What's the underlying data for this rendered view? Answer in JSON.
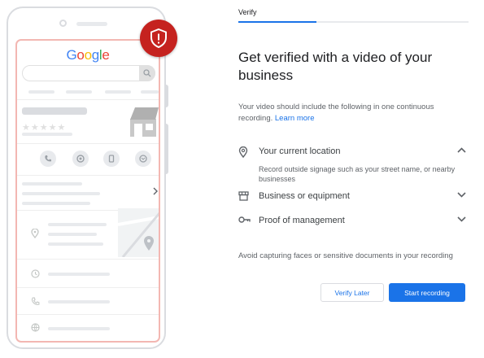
{
  "phone": {
    "logo_text": "Google",
    "logo_colors": [
      "#4285f4",
      "#ea4335",
      "#fbbc05",
      "#4285f4",
      "#34a853",
      "#ea4335"
    ],
    "badge_icon": "shield-alert-icon",
    "badge_color": "#c5221f",
    "action_icons": [
      "phone-icon",
      "directions-icon",
      "save-icon",
      "website-icon"
    ],
    "row_icons": [
      "location-pin-icon",
      "clock-icon",
      "phone-icon",
      "globe-icon"
    ],
    "rating_stars": 5
  },
  "tab": {
    "label": "Verify",
    "progress": 0.34,
    "accent": "#1a73e8"
  },
  "main": {
    "title": "Get verified with a video of your business",
    "description": "Your video should include the following in one continuous recording.",
    "learn_more": "Learn more",
    "items": [
      {
        "icon": "location-pin-icon",
        "label": "Your current location",
        "expanded": true,
        "detail": "Record outside signage such as your street name, or nearby businesses"
      },
      {
        "icon": "storefront-icon",
        "label": "Business or equipment",
        "expanded": false
      },
      {
        "icon": "key-icon",
        "label": "Proof of management",
        "expanded": false
      }
    ],
    "note": "Avoid capturing faces or sensitive documents in your recording"
  },
  "buttons": {
    "secondary": "Verify Later",
    "primary": "Start recording"
  }
}
